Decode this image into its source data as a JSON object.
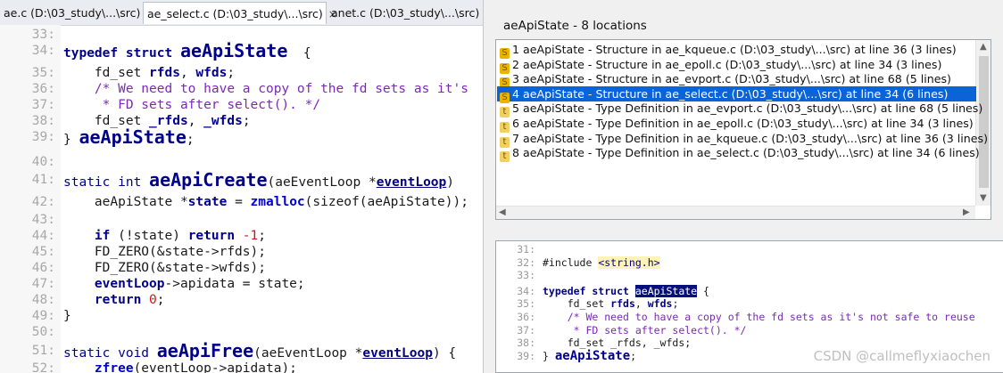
{
  "tabs": [
    {
      "label": "ae.c (D:\\03_study\\...\\src)",
      "active": false
    },
    {
      "label": "ae_select.c (D:\\03_study\\...\\src)",
      "active": true
    },
    {
      "label": "anet.c (D:\\03_study\\...\\src)",
      "active": false
    }
  ],
  "tab_close_symbol": "×",
  "editor": {
    "lines": [
      {
        "n": "33:",
        "parts": []
      },
      {
        "n": "34:",
        "parts": [
          [
            "kw",
            "typedef struct "
          ],
          [
            "big",
            "aeApiState"
          ],
          [
            "",
            "  {"
          ]
        ]
      },
      {
        "n": "35:",
        "parts": [
          [
            "",
            "    fd_set "
          ],
          [
            "kw",
            "rfds"
          ],
          [
            "",
            ", "
          ],
          [
            "kw",
            "wfds"
          ],
          [
            "",
            ";"
          ]
        ]
      },
      {
        "n": "36:",
        "parts": [
          [
            "cm",
            "    /* We need to have a copy of the fd sets as it's"
          ]
        ]
      },
      {
        "n": "37:",
        "parts": [
          [
            "cm",
            "     * FD sets after select(). */"
          ]
        ]
      },
      {
        "n": "38:",
        "parts": [
          [
            "",
            "    fd_set "
          ],
          [
            "kw",
            "_rfds"
          ],
          [
            "",
            ", "
          ],
          [
            "kw",
            "_wfds"
          ],
          [
            "",
            ";"
          ]
        ]
      },
      {
        "n": "39:",
        "parts": [
          [
            "",
            "} "
          ],
          [
            "big",
            "aeApiState"
          ],
          [
            "",
            ";"
          ]
        ]
      },
      {
        "n": "40:",
        "parts": []
      },
      {
        "n": "41:",
        "parts": [
          [
            "ty",
            "static int "
          ],
          [
            "big",
            "aeApiCreate"
          ],
          [
            "",
            "(aeEventLoop *"
          ],
          [
            "lnk",
            "eventLoop"
          ],
          [
            "",
            ")"
          ]
        ]
      },
      {
        "n": "42:",
        "parts": [
          [
            "",
            "    aeApiState *"
          ],
          [
            "kw",
            "state"
          ],
          [
            "",
            " = "
          ],
          [
            "fnc",
            "zmalloc"
          ],
          [
            "",
            "(sizeof(aeApiState));"
          ]
        ]
      },
      {
        "n": "43:",
        "parts": []
      },
      {
        "n": "44:",
        "parts": [
          [
            "kw",
            "    if "
          ],
          [
            "",
            "(!state) "
          ],
          [
            "kw",
            "return "
          ],
          [
            "num",
            "-1"
          ],
          [
            "",
            ";"
          ]
        ]
      },
      {
        "n": "45:",
        "parts": [
          [
            "",
            "    FD_ZERO(&state->rfds);"
          ]
        ]
      },
      {
        "n": "46:",
        "parts": [
          [
            "",
            "    FD_ZERO(&state->wfds);"
          ]
        ]
      },
      {
        "n": "47:",
        "parts": [
          [
            "kw",
            "    eventLoop"
          ],
          [
            "",
            "->apidata = state;"
          ]
        ]
      },
      {
        "n": "48:",
        "parts": [
          [
            "kw",
            "    return "
          ],
          [
            "num",
            "0"
          ],
          [
            "",
            ";"
          ]
        ]
      },
      {
        "n": "49:",
        "parts": [
          [
            "",
            "}"
          ]
        ]
      },
      {
        "n": "50:",
        "parts": []
      },
      {
        "n": "51:",
        "parts": [
          [
            "ty",
            "static void "
          ],
          [
            "big",
            "aeApiFree"
          ],
          [
            "",
            "(aeEventLoop *"
          ],
          [
            "lnk",
            "eventLoop"
          ],
          [
            "",
            ") {"
          ]
        ]
      },
      {
        "n": "52:",
        "parts": [
          [
            "",
            "    "
          ],
          [
            "fnc",
            "zfree"
          ],
          [
            "",
            "(eventLoop->apidata);"
          ]
        ]
      }
    ]
  },
  "locations": {
    "title": "aeApiState - 8 locations",
    "items": [
      {
        "icon": "structure-icon",
        "badge": "S",
        "text": "1 aeApiState - Structure in ae_kqueue.c (D:\\03_study\\...\\src) at line 36 (3 lines)",
        "selected": false
      },
      {
        "icon": "structure-icon",
        "badge": "S",
        "text": "2 aeApiState - Structure in ae_epoll.c (D:\\03_study\\...\\src) at line 34 (3 lines)",
        "selected": false
      },
      {
        "icon": "structure-icon",
        "badge": "S",
        "text": "3 aeApiState - Structure in ae_evport.c (D:\\03_study\\...\\src) at line 68 (5 lines)",
        "selected": false
      },
      {
        "icon": "structure-icon",
        "badge": "S",
        "text": "4 aeApiState - Structure in ae_select.c (D:\\03_study\\...\\src) at line 34 (6 lines)",
        "selected": true
      },
      {
        "icon": "type-definition-icon",
        "badge": "t",
        "text": "5 aeApiState - Type Definition in ae_evport.c (D:\\03_study\\...\\src) at line 68 (5 lines)",
        "selected": false
      },
      {
        "icon": "type-definition-icon",
        "badge": "t",
        "text": "6 aeApiState - Type Definition in ae_epoll.c (D:\\03_study\\...\\src) at line 34 (3 lines)",
        "selected": false
      },
      {
        "icon": "type-definition-icon",
        "badge": "t",
        "text": "7 aeApiState - Type Definition in ae_kqueue.c (D:\\03_study\\...\\src) at line 36 (3 lines)",
        "selected": false
      },
      {
        "icon": "type-definition-icon",
        "badge": "t",
        "text": "8 aeApiState - Type Definition in ae_select.c (D:\\03_study\\...\\src) at line 34 (6 lines)",
        "selected": false
      }
    ]
  },
  "preview": {
    "lines": [
      {
        "n": "31:",
        "parts": []
      },
      {
        "n": "32:",
        "parts": [
          [
            "",
            "#include "
          ],
          [
            "str",
            "<string.h>"
          ]
        ]
      },
      {
        "n": "33:",
        "parts": []
      },
      {
        "n": "34:",
        "parts": [
          [
            "kw",
            "typedef struct "
          ],
          [
            "hl",
            "aeApiState"
          ],
          [
            "",
            " {"
          ]
        ]
      },
      {
        "n": "35:",
        "parts": [
          [
            "",
            "    fd_set "
          ],
          [
            "kw",
            "rfds"
          ],
          [
            "",
            ", "
          ],
          [
            "kw",
            "wfds"
          ],
          [
            "",
            ";"
          ]
        ]
      },
      {
        "n": "36:",
        "parts": [
          [
            "cm",
            "    /* We need to have a copy of the fd sets as it's not safe to reuse"
          ]
        ]
      },
      {
        "n": "37:",
        "parts": [
          [
            "cm",
            "     * FD sets after select(). */"
          ]
        ]
      },
      {
        "n": "38:",
        "parts": [
          [
            "",
            "    fd_set _rfds, _wfds;"
          ]
        ]
      },
      {
        "n": "39:",
        "parts": [
          [
            "",
            "} "
          ],
          [
            "pbig",
            "aeApiState"
          ],
          [
            "",
            ";"
          ]
        ]
      }
    ]
  },
  "watermark": "CSDN @callmeflyxiaochen"
}
